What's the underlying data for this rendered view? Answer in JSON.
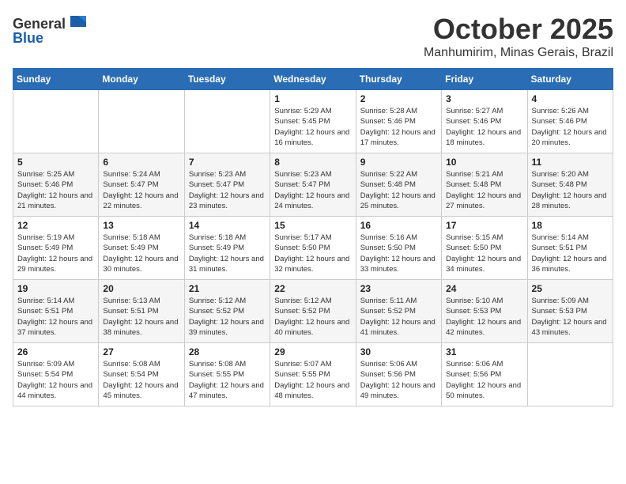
{
  "header": {
    "logo_general": "General",
    "logo_blue": "Blue",
    "month": "October 2025",
    "location": "Manhumirim, Minas Gerais, Brazil"
  },
  "days_of_week": [
    "Sunday",
    "Monday",
    "Tuesday",
    "Wednesday",
    "Thursday",
    "Friday",
    "Saturday"
  ],
  "weeks": [
    {
      "days": [
        {
          "num": "",
          "info": ""
        },
        {
          "num": "",
          "info": ""
        },
        {
          "num": "",
          "info": ""
        },
        {
          "num": "1",
          "info": "Sunrise: 5:29 AM\nSunset: 5:45 PM\nDaylight: 12 hours and 16 minutes."
        },
        {
          "num": "2",
          "info": "Sunrise: 5:28 AM\nSunset: 5:46 PM\nDaylight: 12 hours and 17 minutes."
        },
        {
          "num": "3",
          "info": "Sunrise: 5:27 AM\nSunset: 5:46 PM\nDaylight: 12 hours and 18 minutes."
        },
        {
          "num": "4",
          "info": "Sunrise: 5:26 AM\nSunset: 5:46 PM\nDaylight: 12 hours and 20 minutes."
        }
      ]
    },
    {
      "days": [
        {
          "num": "5",
          "info": "Sunrise: 5:25 AM\nSunset: 5:46 PM\nDaylight: 12 hours and 21 minutes."
        },
        {
          "num": "6",
          "info": "Sunrise: 5:24 AM\nSunset: 5:47 PM\nDaylight: 12 hours and 22 minutes."
        },
        {
          "num": "7",
          "info": "Sunrise: 5:23 AM\nSunset: 5:47 PM\nDaylight: 12 hours and 23 minutes."
        },
        {
          "num": "8",
          "info": "Sunrise: 5:23 AM\nSunset: 5:47 PM\nDaylight: 12 hours and 24 minutes."
        },
        {
          "num": "9",
          "info": "Sunrise: 5:22 AM\nSunset: 5:48 PM\nDaylight: 12 hours and 25 minutes."
        },
        {
          "num": "10",
          "info": "Sunrise: 5:21 AM\nSunset: 5:48 PM\nDaylight: 12 hours and 27 minutes."
        },
        {
          "num": "11",
          "info": "Sunrise: 5:20 AM\nSunset: 5:48 PM\nDaylight: 12 hours and 28 minutes."
        }
      ]
    },
    {
      "days": [
        {
          "num": "12",
          "info": "Sunrise: 5:19 AM\nSunset: 5:49 PM\nDaylight: 12 hours and 29 minutes."
        },
        {
          "num": "13",
          "info": "Sunrise: 5:18 AM\nSunset: 5:49 PM\nDaylight: 12 hours and 30 minutes."
        },
        {
          "num": "14",
          "info": "Sunrise: 5:18 AM\nSunset: 5:49 PM\nDaylight: 12 hours and 31 minutes."
        },
        {
          "num": "15",
          "info": "Sunrise: 5:17 AM\nSunset: 5:50 PM\nDaylight: 12 hours and 32 minutes."
        },
        {
          "num": "16",
          "info": "Sunrise: 5:16 AM\nSunset: 5:50 PM\nDaylight: 12 hours and 33 minutes."
        },
        {
          "num": "17",
          "info": "Sunrise: 5:15 AM\nSunset: 5:50 PM\nDaylight: 12 hours and 34 minutes."
        },
        {
          "num": "18",
          "info": "Sunrise: 5:14 AM\nSunset: 5:51 PM\nDaylight: 12 hours and 36 minutes."
        }
      ]
    },
    {
      "days": [
        {
          "num": "19",
          "info": "Sunrise: 5:14 AM\nSunset: 5:51 PM\nDaylight: 12 hours and 37 minutes."
        },
        {
          "num": "20",
          "info": "Sunrise: 5:13 AM\nSunset: 5:51 PM\nDaylight: 12 hours and 38 minutes."
        },
        {
          "num": "21",
          "info": "Sunrise: 5:12 AM\nSunset: 5:52 PM\nDaylight: 12 hours and 39 minutes."
        },
        {
          "num": "22",
          "info": "Sunrise: 5:12 AM\nSunset: 5:52 PM\nDaylight: 12 hours and 40 minutes."
        },
        {
          "num": "23",
          "info": "Sunrise: 5:11 AM\nSunset: 5:52 PM\nDaylight: 12 hours and 41 minutes."
        },
        {
          "num": "24",
          "info": "Sunrise: 5:10 AM\nSunset: 5:53 PM\nDaylight: 12 hours and 42 minutes."
        },
        {
          "num": "25",
          "info": "Sunrise: 5:09 AM\nSunset: 5:53 PM\nDaylight: 12 hours and 43 minutes."
        }
      ]
    },
    {
      "days": [
        {
          "num": "26",
          "info": "Sunrise: 5:09 AM\nSunset: 5:54 PM\nDaylight: 12 hours and 44 minutes."
        },
        {
          "num": "27",
          "info": "Sunrise: 5:08 AM\nSunset: 5:54 PM\nDaylight: 12 hours and 45 minutes."
        },
        {
          "num": "28",
          "info": "Sunrise: 5:08 AM\nSunset: 5:55 PM\nDaylight: 12 hours and 47 minutes."
        },
        {
          "num": "29",
          "info": "Sunrise: 5:07 AM\nSunset: 5:55 PM\nDaylight: 12 hours and 48 minutes."
        },
        {
          "num": "30",
          "info": "Sunrise: 5:06 AM\nSunset: 5:56 PM\nDaylight: 12 hours and 49 minutes."
        },
        {
          "num": "31",
          "info": "Sunrise: 5:06 AM\nSunset: 5:56 PM\nDaylight: 12 hours and 50 minutes."
        },
        {
          "num": "",
          "info": ""
        }
      ]
    }
  ]
}
